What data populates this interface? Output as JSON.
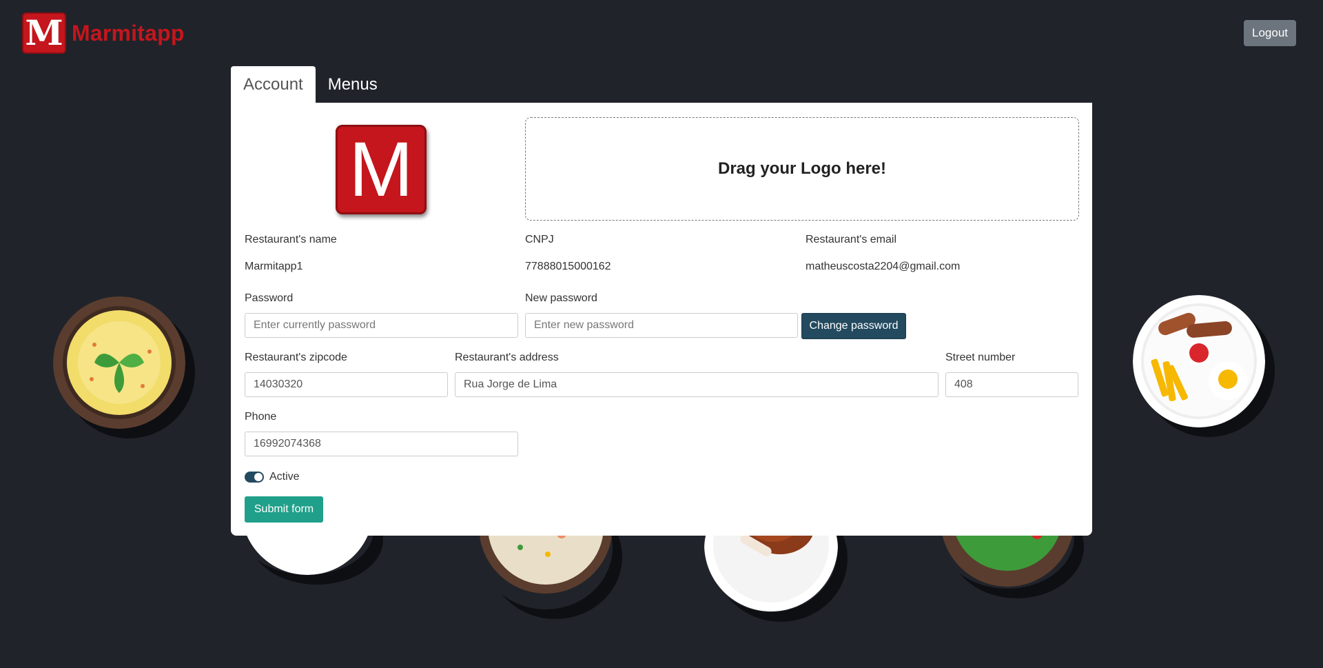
{
  "app": {
    "brand_name": "Marmitapp",
    "brand_letter": "M",
    "brand_color": "#c4161c"
  },
  "header": {
    "logout_label": "Logout"
  },
  "tabs": [
    {
      "label": "Account",
      "active": true
    },
    {
      "label": "Menus",
      "active": false
    }
  ],
  "account": {
    "logo_letter": "M",
    "dropzone_text": "Drag your Logo here!",
    "restaurant_name_label": "Restaurant's name",
    "restaurant_name_value": "Marmitapp1",
    "cnpj_label": "CNPJ",
    "cnpj_value": "77888015000162",
    "email_label": "Restaurant's email",
    "email_value": "matheuscosta2204@gmail.com",
    "password_label": "Password",
    "password_placeholder": "Enter currently password",
    "new_password_label": "New password",
    "new_password_placeholder": "Enter new password",
    "change_password_label": "Change password",
    "zipcode_label": "Restaurant's zipcode",
    "zipcode_value": "14030320",
    "address_label": "Restaurant's address",
    "address_value": "Rua Jorge de Lima",
    "street_number_label": "Street number",
    "street_number_value": "408",
    "phone_label": "Phone",
    "phone_value": "16992074368",
    "active_label": "Active",
    "active_value": true,
    "submit_label": "Submit form"
  },
  "colors": {
    "background": "#20232a",
    "primary_dark": "#234a5f",
    "submit": "#20a08a",
    "logout": "#6c757d"
  },
  "decor_icons": [
    "omelette-plate-icon",
    "breakfast-plate-icon",
    "noodle-plate-icon",
    "paella-plate-icon",
    "chicken-plate-icon",
    "salad-plate-icon"
  ]
}
